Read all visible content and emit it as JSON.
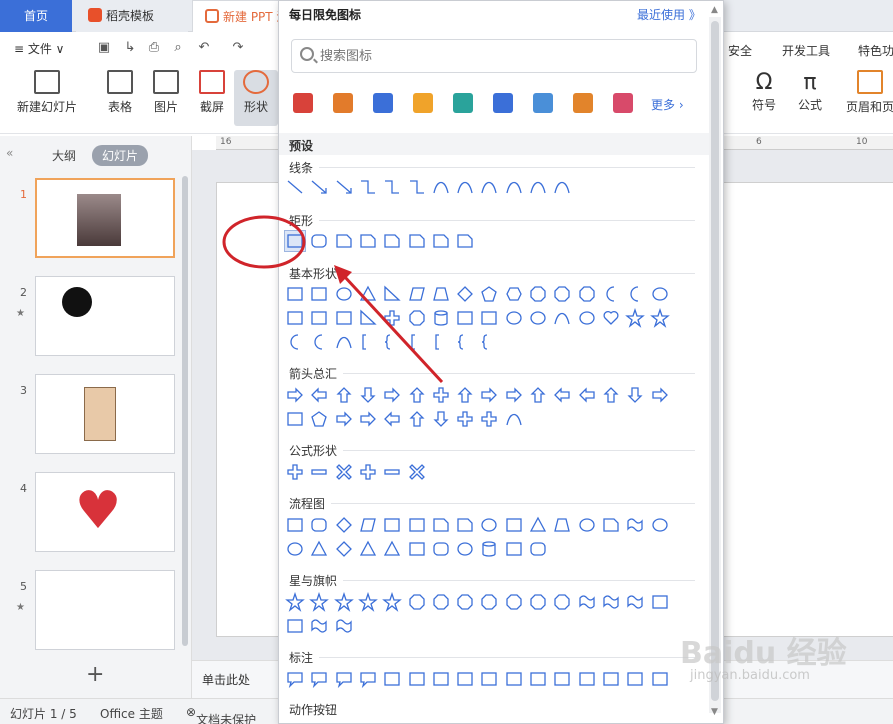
{
  "tabs": {
    "home": "首页",
    "daoke": "稻壳模板",
    "new_ppt": "新建 PPT 演"
  },
  "menubar": {
    "file": "≡ 文件 ∨",
    "right_items": [
      "安全",
      "开发工具",
      "特色功"
    ]
  },
  "ribbon": {
    "new_slide": "新建幻灯片",
    "table": "表格",
    "picture": "图片",
    "screenshot": "截屏",
    "shape": "形状",
    "symbol": "符号",
    "formula": "公式",
    "header_footer": "页眉和页"
  },
  "ruler": {
    "left": "16",
    "mid": "6",
    "right": "10"
  },
  "sidepanel": {
    "outline_tab": "大纲",
    "slides_tab": "幻灯片",
    "slides": [
      {
        "num": "1",
        "star": ""
      },
      {
        "num": "2",
        "star": "★"
      },
      {
        "num": "3",
        "star": ""
      },
      {
        "num": "4",
        "star": ""
      },
      {
        "num": "5",
        "star": "★"
      }
    ],
    "add": "+"
  },
  "notes": {
    "placeholder": "单击此处"
  },
  "statusbar": {
    "slide_count": "幻灯片 1 / 5",
    "theme": "Office 主题",
    "protect": "文档未保护"
  },
  "panel": {
    "title": "每日限免图标",
    "recent": "最近使用 》",
    "search_placeholder": "搜索图标",
    "more": "更多 ›",
    "preset": "预设",
    "categories": {
      "lines": "线条",
      "rect": "矩形",
      "basic": "基本形状",
      "arrows": "箭头总汇",
      "formula": "公式形状",
      "flowchart": "流程图",
      "stars": "星与旗帜",
      "callouts": "标注",
      "action": "动作按钮"
    },
    "free_icon_colors": [
      "#d8423a",
      "#e27b2b",
      "#3b6fd8",
      "#f0a32a",
      "#2aa39b",
      "#3b6fd8",
      "#4a8fd8",
      "#e2842b",
      "#d84a6a"
    ]
  },
  "colors": {
    "accent": "#3b6fd8",
    "annotation": "#d0242a",
    "shape_stroke": "#3b6fd8"
  },
  "watermark": {
    "main": "Baidu 经验",
    "sub": "jingyan.baidu.com"
  }
}
